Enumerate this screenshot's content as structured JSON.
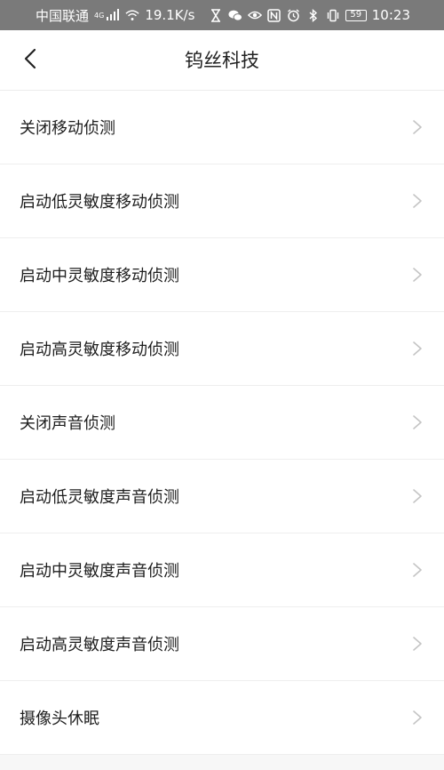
{
  "status_bar": {
    "carrier": "中国联通",
    "network_badge": "4G",
    "speed": "19.1K/s",
    "battery": "59",
    "time": "10:23",
    "icons": [
      "signal-icon",
      "wifi-icon",
      "hourglass-icon",
      "wechat-icon",
      "eye-icon",
      "nfc-icon",
      "alarm-icon",
      "bluetooth-icon",
      "vibrate-icon",
      "battery-icon"
    ]
  },
  "header": {
    "title": "钨丝科技",
    "back_icon": "chevron-left-icon"
  },
  "menu": {
    "items": [
      {
        "label": "关闭移动侦测"
      },
      {
        "label": "启动低灵敏度移动侦测"
      },
      {
        "label": "启动中灵敏度移动侦测"
      },
      {
        "label": "启动高灵敏度移动侦测"
      },
      {
        "label": "关闭声音侦测"
      },
      {
        "label": "启动低灵敏度声音侦测"
      },
      {
        "label": "启动中灵敏度声音侦测"
      },
      {
        "label": "启动高灵敏度声音侦测"
      },
      {
        "label": "摄像头休眠"
      }
    ],
    "item_icon": "chevron-right-icon"
  },
  "colors": {
    "status_bar_bg": "#7a7a7a",
    "text": "#1e1e1e",
    "chevron": "#c4c4c4",
    "divider": "#eeeeee"
  }
}
